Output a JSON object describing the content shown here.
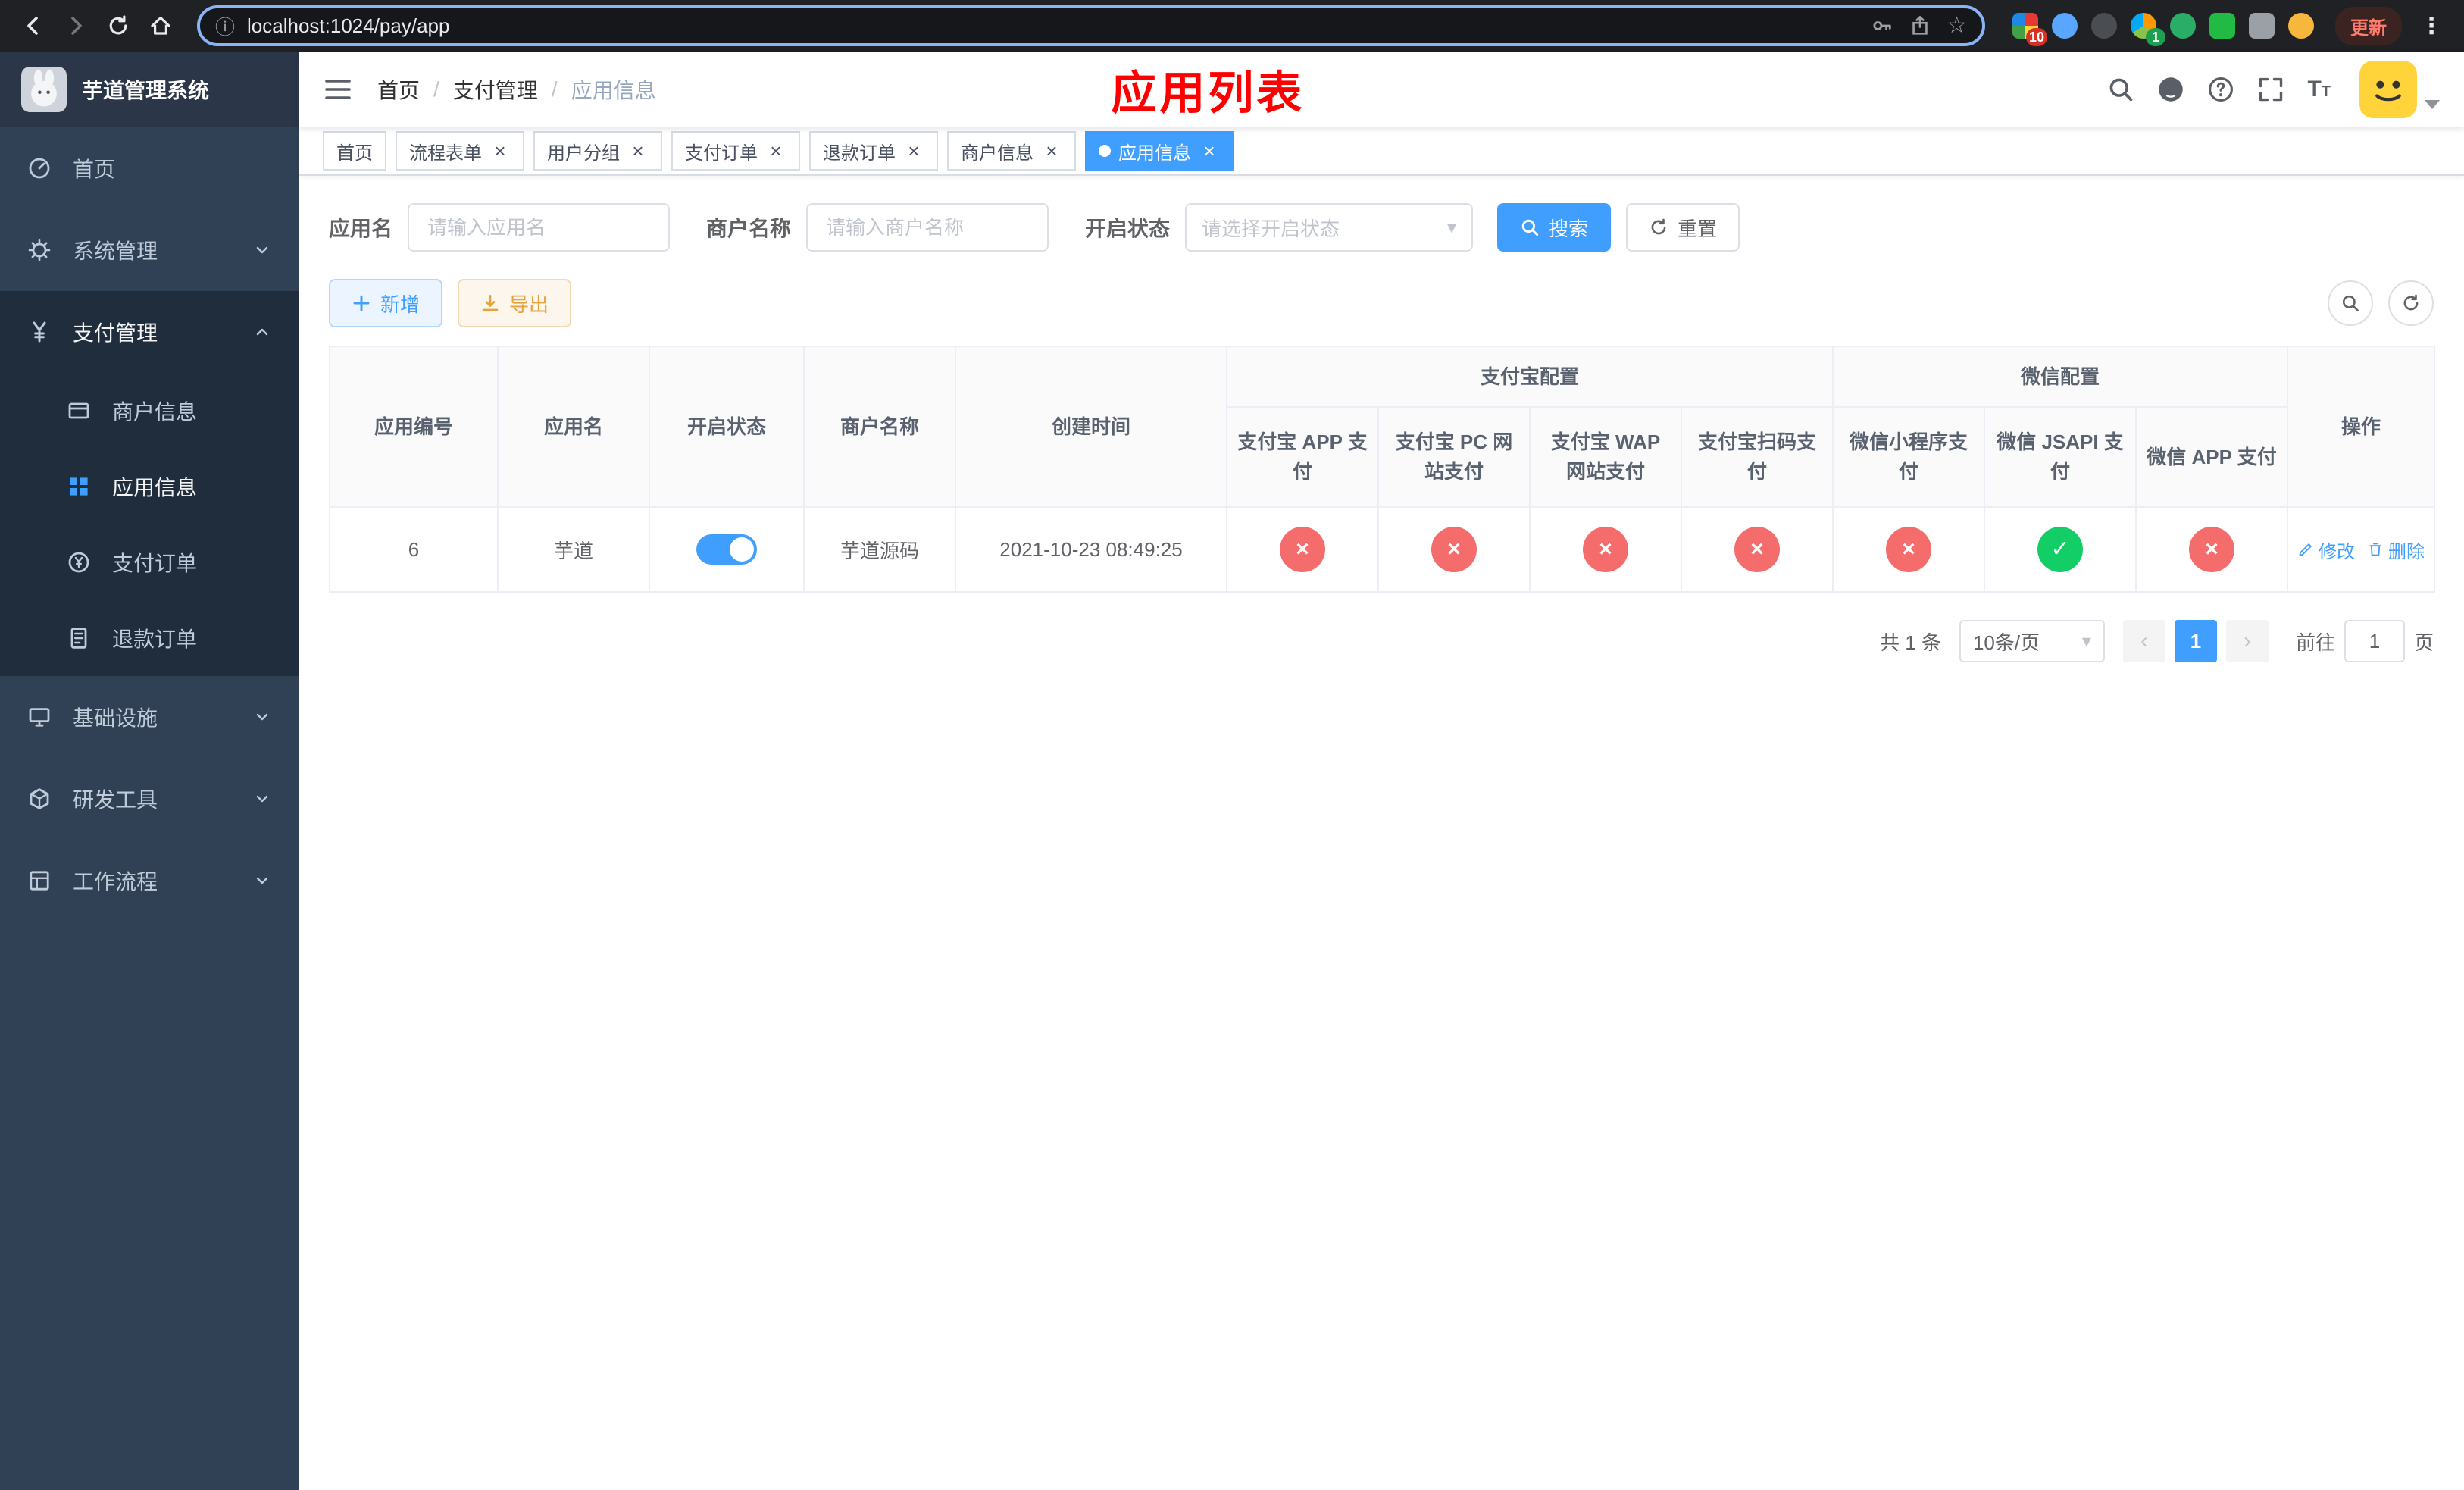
{
  "browser": {
    "url": "localhost:1024/pay/app",
    "update_label": "更新",
    "extensions_badge_1": "10",
    "extensions_badge_2": "1"
  },
  "icons": {
    "dots": "⋮",
    "star": "☆",
    "prev": "‹",
    "next": "›",
    "caret": "▾",
    "check": "✓",
    "close": "×",
    "info": "ⓘ"
  },
  "sidebar": {
    "logo_title": "芋道管理系统",
    "items": [
      {
        "label": "首页"
      },
      {
        "label": "系统管理"
      },
      {
        "label": "支付管理"
      },
      {
        "label": "商户信息"
      },
      {
        "label": "应用信息"
      },
      {
        "label": "支付订单"
      },
      {
        "label": "退款订单"
      },
      {
        "label": "基础设施"
      },
      {
        "label": "研发工具"
      },
      {
        "label": "工作流程"
      }
    ]
  },
  "navbar": {
    "breadcrumb": [
      "首页",
      "支付管理",
      "应用信息"
    ],
    "breadcrumb_separator": "/",
    "annotation_title": "应用列表"
  },
  "tabs": [
    {
      "label": "首页"
    },
    {
      "label": "流程表单"
    },
    {
      "label": "用户分组"
    },
    {
      "label": "支付订单"
    },
    {
      "label": "退款订单"
    },
    {
      "label": "商户信息"
    },
    {
      "label": "应用信息"
    }
  ],
  "filters": {
    "app_name_label": "应用名",
    "app_name_placeholder": "请输入应用名",
    "merchant_label": "商户名称",
    "merchant_placeholder": "请输入商户名称",
    "status_label": "开启状态",
    "status_placeholder": "请选择开启状态",
    "search_label": "搜索",
    "reset_label": "重置"
  },
  "toolbar": {
    "add_label": "新增",
    "export_label": "导出"
  },
  "table": {
    "groups": {
      "alipay": "支付宝配置",
      "wechat": "微信配置"
    },
    "columns": [
      "应用编号",
      "应用名",
      "开启状态",
      "商户名称",
      "创建时间",
      "支付宝 APP 支付",
      "支付宝 PC 网站支付",
      "支付宝 WAP 网站支付",
      "支付宝扫码支付",
      "微信小程序支付",
      "微信 JSAPI 支付",
      "微信 APP 支付",
      "操作"
    ],
    "row": {
      "id": "6",
      "name": "芋道",
      "enabled": true,
      "merchant": "芋道源码",
      "created": "2021-10-23 08:49:25",
      "statuses": [
        "cross",
        "cross",
        "cross",
        "cross",
        "cross",
        "check",
        "cross"
      ],
      "edit_label": "修改",
      "delete_label": "删除"
    }
  },
  "pagination": {
    "total": "共 1 条",
    "page_size": "10条/页",
    "current_page": "1",
    "goto_label": "前往",
    "goto_value": "1",
    "goto_suffix": "页"
  }
}
